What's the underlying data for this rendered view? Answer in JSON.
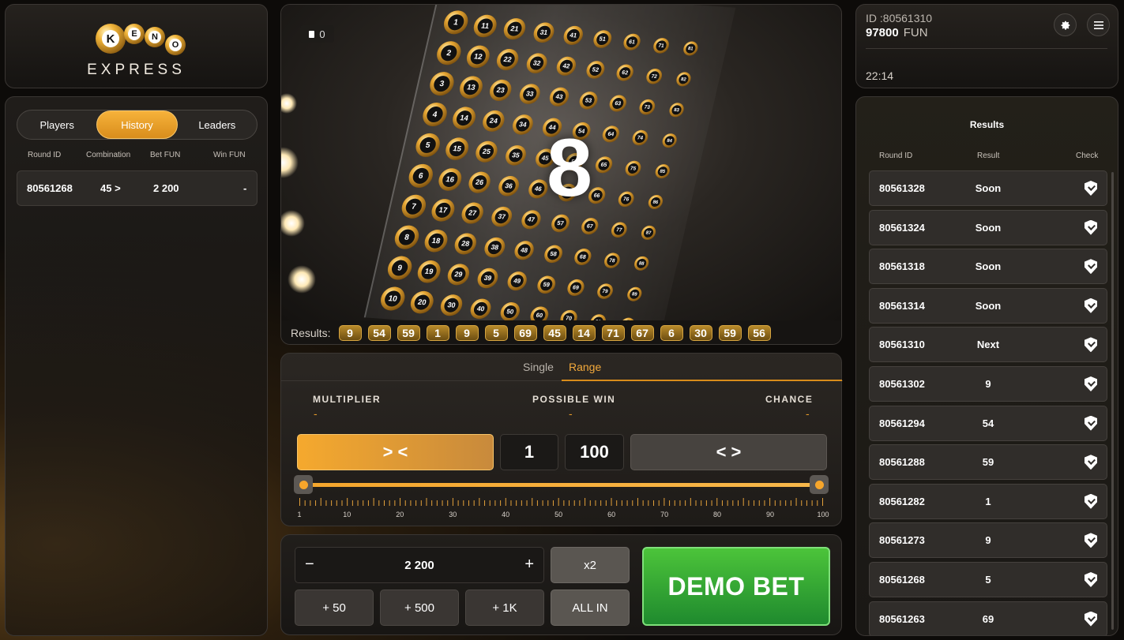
{
  "logo": {
    "text": "EXPRESS",
    "keno_letters": [
      "K",
      "E",
      "N",
      "O"
    ]
  },
  "left": {
    "tabs": [
      {
        "label": "Players",
        "active": false
      },
      {
        "label": "History",
        "active": true
      },
      {
        "label": "Leaders",
        "active": false
      }
    ],
    "columns": [
      "Round ID",
      "Combination",
      "Bet  FUN",
      "Win  FUN"
    ],
    "rows": [
      {
        "round_id": "80561268",
        "combination": "45 >",
        "bet": "2 200",
        "win": "-"
      }
    ]
  },
  "video": {
    "counter": "0",
    "current_number": "8",
    "results_label": "Results:",
    "results": [
      "9",
      "54",
      "59",
      "1",
      "9",
      "5",
      "69",
      "45",
      "14",
      "71",
      "67",
      "6",
      "30",
      "59",
      "56"
    ]
  },
  "config": {
    "modes": {
      "single": "Single",
      "range": "Range"
    },
    "active_mode": "Range",
    "stats": [
      {
        "label": "MULTIPLIER",
        "value": "-"
      },
      {
        "label": "POSSIBLE WIN",
        "value": "-"
      },
      {
        "label": "CHANCE",
        "value": "-"
      }
    ],
    "narrow_label": "> <",
    "widen_label": "< >",
    "range_min": "1",
    "range_max": "100",
    "slider": {
      "min": 1,
      "max": 100,
      "low": 1,
      "high": 100
    },
    "tick_labels": [
      "1",
      "10",
      "20",
      "30",
      "40",
      "50",
      "60",
      "70",
      "80",
      "90",
      "100"
    ]
  },
  "bet": {
    "amount": "2 200",
    "minus": "−",
    "plus": "+",
    "quick": [
      "+ 50",
      "+ 500",
      "+ 1K"
    ],
    "double_label": "x2",
    "all_in_label": "ALL IN",
    "demo_bet_label": "DEMO BET"
  },
  "account": {
    "id": "ID :80561310",
    "balance": "97800",
    "currency": "FUN",
    "time": "22:14",
    "settings_icon": "gear-icon",
    "menu_icon": "hamburger-menu-icon"
  },
  "results_panel": {
    "title": "Results",
    "columns": [
      "Round ID",
      "Result",
      "Check"
    ],
    "rows": [
      {
        "round_id": "80561328",
        "result": "Soon"
      },
      {
        "round_id": "80561324",
        "result": "Soon"
      },
      {
        "round_id": "80561318",
        "result": "Soon"
      },
      {
        "round_id": "80561314",
        "result": "Soon"
      },
      {
        "round_id": "80561310",
        "result": "Next"
      },
      {
        "round_id": "80561302",
        "result": "9"
      },
      {
        "round_id": "80561294",
        "result": "54"
      },
      {
        "round_id": "80561288",
        "result": "59"
      },
      {
        "round_id": "80561282",
        "result": "1"
      },
      {
        "round_id": "80561273",
        "result": "9"
      },
      {
        "round_id": "80561268",
        "result": "5"
      },
      {
        "round_id": "80561263",
        "result": "69"
      }
    ]
  },
  "colors": {
    "accent": "#f5a92e",
    "bet_green": "#2da83a",
    "panel": "#26231f"
  }
}
